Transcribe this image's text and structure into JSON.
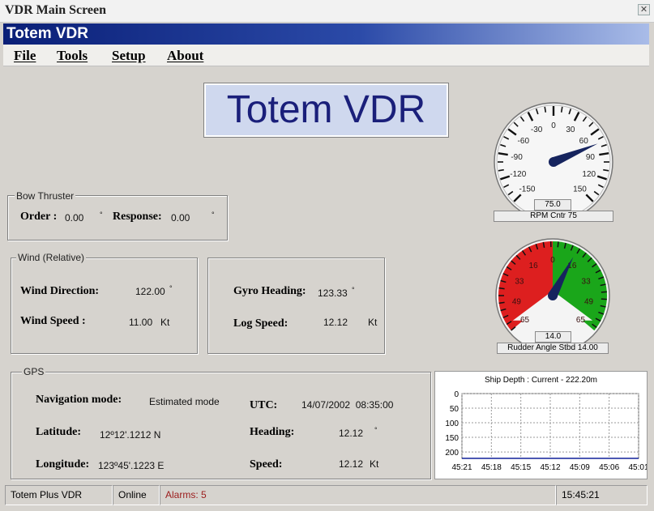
{
  "window": {
    "title": "VDR Main Screen",
    "close_glyph": "✕"
  },
  "banner": {
    "title": "Totem VDR"
  },
  "menu": {
    "items": [
      "File",
      "Tools",
      "Setup",
      "About"
    ]
  },
  "logo": {
    "text": "Totem VDR",
    "color": "#1a1f7a"
  },
  "bow_thruster": {
    "title": "Bow Thruster",
    "order_label": "Order :",
    "order_value": "0.00",
    "order_unit": "°",
    "response_label": "Response:",
    "response_value": "0.00",
    "response_unit": "°"
  },
  "wind": {
    "title": "Wind (Relative)",
    "direction_label": "Wind Direction:",
    "direction_value": "122.00",
    "direction_unit": "°",
    "speed_label": "Wind Speed :",
    "speed_value": "11.00",
    "speed_unit": "Kt"
  },
  "gyro": {
    "heading_label": "Gyro Heading:",
    "heading_value": "123.33",
    "heading_unit": "°",
    "log_label": "Log Speed:",
    "log_value": "12.12",
    "log_unit": "Kt"
  },
  "gps": {
    "title": "GPS",
    "nav_mode_label": "Navigation mode:",
    "nav_mode_value": "Estimated mode",
    "utc_label": "UTC:",
    "utc_value": "14/07/2002  08:35:00",
    "lat_label": "Latitude:",
    "lat_value": "12º12'.1212 N",
    "heading_label": "Heading:",
    "heading_value": "12.12",
    "heading_unit": "°",
    "lon_label": "Longitude:",
    "lon_value": "123º45'.1223 E",
    "speed_label": "Speed:",
    "speed_value": "12.12",
    "speed_unit": "Kt"
  },
  "rpm_gauge": {
    "ticks": [
      "-150",
      "-120",
      "-90",
      "-60",
      "-30",
      "0",
      "30",
      "60",
      "90",
      "120",
      "150"
    ],
    "value": 75,
    "readout": "75.0",
    "caption": "RPM Cntr 75"
  },
  "rudder_gauge": {
    "ticks": [
      "65",
      "49",
      "33",
      "16",
      "0",
      "16",
      "33",
      "49",
      "65"
    ],
    "value": 14,
    "readout": "14.0",
    "caption": "Rudder Angle Stbd 14.00",
    "port_color": "#dd1f1f",
    "stbd_color": "#1aa61a"
  },
  "chart_data": {
    "type": "area",
    "title": "Ship Depth : Current - 222.20m",
    "x": [
      "45:21",
      "45:18",
      "45:15",
      "45:12",
      "45:09",
      "45:06",
      "45:01"
    ],
    "y_ticks": [
      "0",
      "50",
      "100",
      "150",
      "200"
    ],
    "ylim": [
      0,
      222
    ],
    "series": [
      {
        "values": [
          222,
          222,
          222,
          222,
          222,
          222,
          222
        ]
      }
    ],
    "color": "#10209a"
  },
  "status": {
    "app": "Totem Plus VDR",
    "connection": "Online",
    "alarms": "Alarms: 5",
    "time": "15:45:21",
    "alarm_color": "#9b1b1b"
  }
}
